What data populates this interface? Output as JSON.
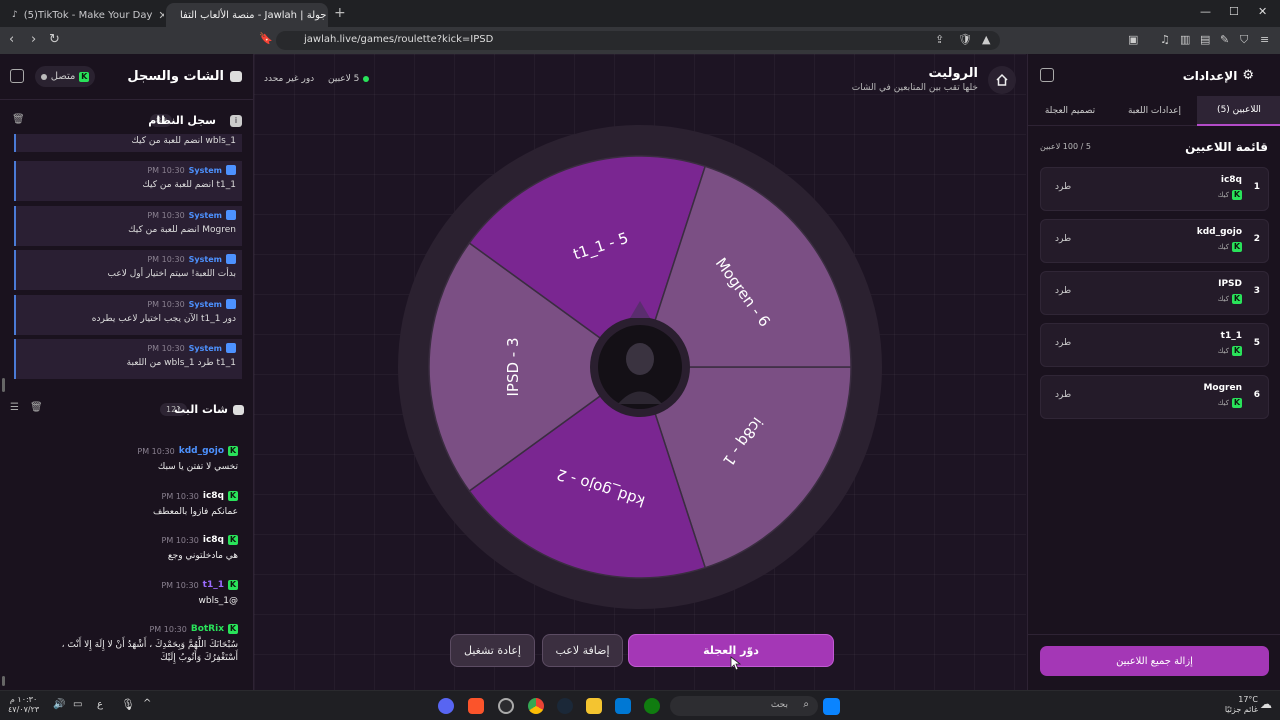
{
  "browser": {
    "tabs": [
      {
        "label": "(5)TikTok - Make Your Day"
      },
      {
        "label": "جولة | Jawlah - منصة الألعاب التفا"
      }
    ],
    "url": "jawlah.live/games/roulette?kick=IPSD"
  },
  "chat_panel": {
    "title": "الشات والسجل",
    "status": "متصل",
    "system_log": {
      "title": "سجل النظام",
      "count": "84",
      "first_partial": "wbls_1 انضم للعبة من كيك",
      "sender": "System",
      "time": "10:30 PM",
      "messages": [
        "t1_1 انضم للعبة من كيك",
        "Mogren انضم للعبة من كيك",
        "بدأت اللعبة! سيتم اختيار أول لاعب",
        "دور t1_1 الآن يجب اختيار لاعب يطرده",
        "t1_1 طرد wbls_1 من اللعبة"
      ]
    },
    "stream_chat": {
      "title": "شات البث",
      "count": "121",
      "messages": [
        {
          "user": "kdd_gojo",
          "time": "10:30 PM",
          "text": "تخسي لا تفتن يا سبك",
          "color": "#4d92ff"
        },
        {
          "user": "ic8q",
          "time": "10:30 PM",
          "text": "عمانكم فازوا بالمعطف",
          "color": "#ffffff"
        },
        {
          "user": "ic8q",
          "time": "10:30 PM",
          "text": "هي مادخلتوني وجع",
          "color": "#ffffff"
        },
        {
          "user": "t1_1",
          "time": "10:30 PM",
          "text": "@wbls_1",
          "color": "#9b6cff"
        },
        {
          "user": "BotRix",
          "time": "10:30 PM",
          "text": "سُبْحَانَكَ اللَّهُمَّ وَبِحَمْدِكَ ، أَشْهَدُ أَنْ لا إِلَهَ إِلا أَنْتَ ،",
          "text2": "أَسْتَغْفِرُكَ وَأَتُوبُ إِلَيْكَ",
          "color": "#29e35a"
        }
      ]
    }
  },
  "game": {
    "title": "الروليت",
    "subtitle": "خلها تقب بين المتابعين في الشات",
    "player_count": "5 لاعبين",
    "turn_status": "دور غير محدد",
    "wheel": {
      "segments": [
        {
          "label": "ic8q - 1",
          "color": "#7b4f84"
        },
        {
          "label": "kdd_gojo - 2",
          "color": "#7a2691"
        },
        {
          "label": "IPSD - 3",
          "color": "#7b4f84"
        },
        {
          "label": "t1_1 - 5",
          "color": "#7a2691"
        },
        {
          "label": "Mogren - 6",
          "color": "#7b4f84"
        }
      ],
      "rim_color": "#2b2130"
    },
    "buttons": {
      "spin": "دوّر العجلة",
      "add": "إضافة لاعب",
      "reset": "إعادة تشغيل"
    }
  },
  "settings": {
    "title": "الإعدادات",
    "tabs": [
      "اللاعبين (5)",
      "إعدادات اللعبة",
      "تصميم العجلة"
    ],
    "list_title": "قائمة اللاعبين",
    "list_count": "5 / 100 لاعبين",
    "platform": "كيك",
    "kick_label": "طرد",
    "players": [
      {
        "num": "1",
        "name": "ic8q"
      },
      {
        "num": "2",
        "name": "kdd_gojo"
      },
      {
        "num": "3",
        "name": "IPSD"
      },
      {
        "num": "5",
        "name": "t1_1"
      },
      {
        "num": "6",
        "name": "Mogren"
      }
    ],
    "remove_all": "إزالة جميع اللاعبين"
  },
  "taskbar": {
    "search": "بحث",
    "weather_temp": "17°C",
    "weather_desc": "غائم جزئيًا",
    "time": "١٠:٣٠ م",
    "date": "٤٧/٠٧/٢٣",
    "lang": "ع"
  },
  "colors": {
    "accent": "#a437b6",
    "kick_green": "#29e35a",
    "system_blue": "#4d92ff"
  }
}
